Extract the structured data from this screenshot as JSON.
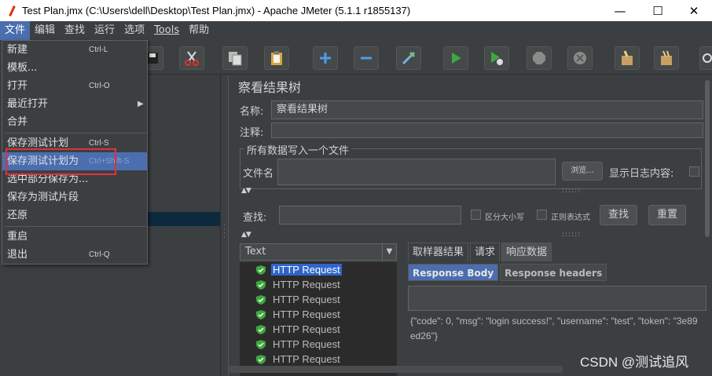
{
  "window": {
    "title": "Test Plan.jmx (C:\\Users\\dell\\Desktop\\Test Plan.jmx) - Apache JMeter (5.1.1 r1855137)",
    "minimize": "—",
    "maximize": "☐",
    "close": "✕"
  },
  "menubar": {
    "items": [
      "文件",
      "编辑",
      "查找",
      "运行",
      "选项",
      "Tools",
      "帮助"
    ]
  },
  "file_menu": {
    "items": [
      {
        "label": "新建",
        "accel": "Ctrl-L"
      },
      {
        "label": "模板...",
        "accel": ""
      },
      {
        "label": "打开",
        "accel": "Ctrl-O"
      },
      {
        "label": "最近打开",
        "accel": ""
      },
      {
        "label": "合并",
        "accel": ""
      },
      {
        "label": "保存测试计划",
        "accel": "Ctrl-S"
      },
      {
        "label": "保存测试计划为",
        "accel": "Ctrl+Shift-S"
      },
      {
        "label": "选中部分保存为...",
        "accel": ""
      },
      {
        "label": "保存为测试片段",
        "accel": ""
      },
      {
        "label": "还原",
        "accel": ""
      },
      {
        "label": "重启",
        "accel": ""
      },
      {
        "label": "退出",
        "accel": "Ctrl-Q"
      }
    ]
  },
  "panel": {
    "title": "察看结果树",
    "name_label": "名称:",
    "name_value": "察看结果树",
    "comment_label": "注释:",
    "group_title": "所有数据写入一个文件",
    "filename_label": "文件名",
    "browse_button": "浏览...",
    "show_log_label": "显示日志内容:",
    "search_label": "查找:",
    "case_sensitive": "区分大小写",
    "regex": "正则表达式",
    "find_button": "查找",
    "reset_button": "重置"
  },
  "renderer": {
    "selected": "Text"
  },
  "results": [
    "HTTP Request",
    "HTTP Request",
    "HTTP Request",
    "HTTP Request",
    "HTTP Request",
    "HTTP Request",
    "HTTP Request"
  ],
  "result_tabs": [
    "取样器结果",
    "请求",
    "响应数据"
  ],
  "response_subtabs": [
    "Response Body",
    "Response headers"
  ],
  "response_body": {
    "line1": "{\"code\": 0, \"msg\": \"login success!\", \"username\": \"test\", \"token\": \"3e89",
    "line2": "ed26\"}"
  },
  "watermark": "CSDN @测试追风",
  "colors": {
    "accent": "#4b6eaf",
    "highlight_box": "#e0313e",
    "selection": "#2f65ca",
    "run_green": "#3ea83e"
  }
}
